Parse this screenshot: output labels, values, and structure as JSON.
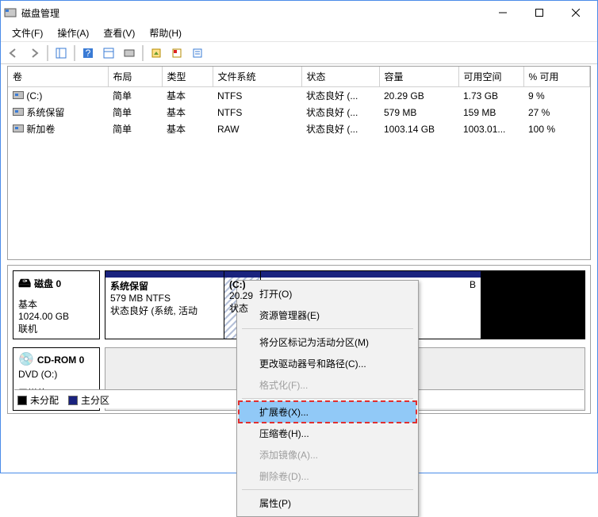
{
  "window": {
    "title": "磁盘管理"
  },
  "menu": {
    "file": "文件(F)",
    "action": "操作(A)",
    "view": "查看(V)",
    "help": "帮助(H)"
  },
  "columns": {
    "volume": "卷",
    "layout": "布局",
    "type": "类型",
    "fs": "文件系统",
    "status": "状态",
    "capacity": "容量",
    "free": "可用空间",
    "pctfree": "% 可用"
  },
  "volumes": [
    {
      "name": "(C:)",
      "layout": "简单",
      "type": "基本",
      "fs": "NTFS",
      "status": "状态良好 (...",
      "capacity": "20.29 GB",
      "free": "1.73 GB",
      "pctfree": "9 %"
    },
    {
      "name": "系统保留",
      "layout": "简单",
      "type": "基本",
      "fs": "NTFS",
      "status": "状态良好 (...",
      "capacity": "579 MB",
      "free": "159 MB",
      "pctfree": "27 %"
    },
    {
      "name": "新加卷",
      "layout": "简单",
      "type": "基本",
      "fs": "RAW",
      "status": "状态良好 (...",
      "capacity": "1003.14 GB",
      "free": "1003.01...",
      "pctfree": "100 %"
    }
  ],
  "disks": {
    "d0": {
      "name": "磁盘 0",
      "type": "基本",
      "size": "1024.00 GB",
      "status": "联机",
      "parts": {
        "p0": {
          "name": "系统保留",
          "cap": "579 MB NTFS",
          "status": "状态良好 (系统, 活动"
        },
        "p1": {
          "name": "(C:)",
          "cap": "20.29",
          "status": "状态"
        },
        "p2": {
          "cap_suffix": "B"
        }
      }
    },
    "cd0": {
      "name": "CD-ROM 0",
      "line2": "DVD (O:)",
      "status": "无媒体"
    }
  },
  "legend": {
    "unalloc": "未分配",
    "primary": "主分区"
  },
  "ctx": {
    "open": "打开(O)",
    "explorer": "资源管理器(E)",
    "mark_active": "将分区标记为活动分区(M)",
    "change_letter": "更改驱动器号和路径(C)...",
    "format": "格式化(F)...",
    "extend": "扩展卷(X)...",
    "shrink": "压缩卷(H)...",
    "add_mirror": "添加镜像(A)...",
    "delete": "删除卷(D)...",
    "properties": "属性(P)"
  },
  "colors": {
    "primary_stripe": "#1a237e",
    "black": "#000000",
    "highlight": "#91c9f7"
  }
}
